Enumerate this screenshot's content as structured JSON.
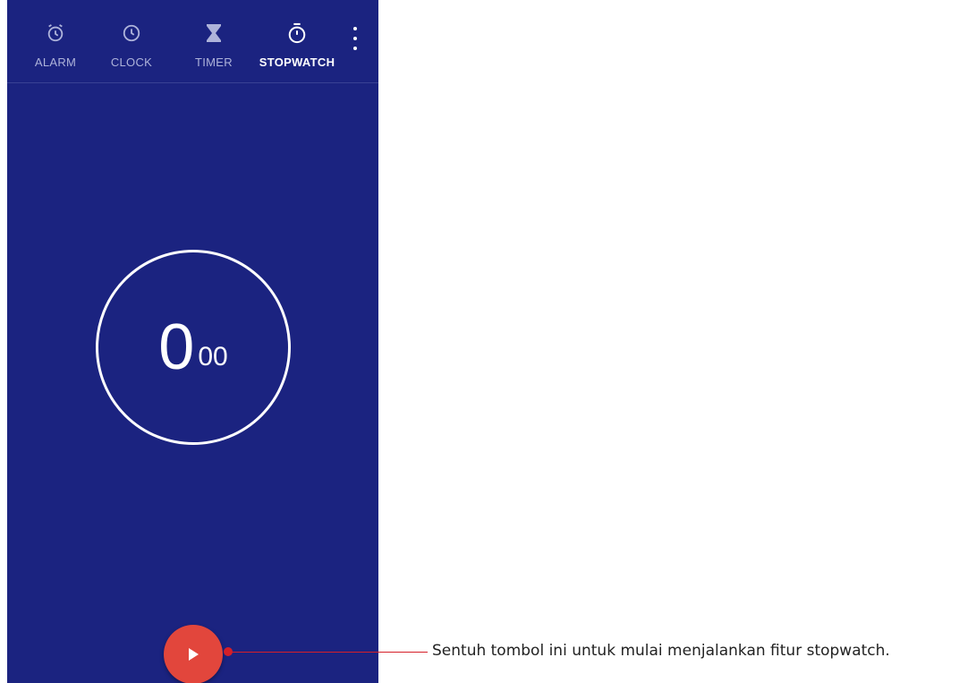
{
  "tabs": [
    {
      "label": "ALARM",
      "icon": "alarm-icon",
      "active": false
    },
    {
      "label": "CLOCK",
      "icon": "clock-icon",
      "active": false
    },
    {
      "label": "TIMER",
      "icon": "hourglass-icon",
      "active": false
    },
    {
      "label": "STOPWATCH",
      "icon": "stopwatch-icon",
      "active": true
    }
  ],
  "overflow_menu": {
    "icon": "more-vert-icon"
  },
  "stopwatch": {
    "seconds": "0",
    "hundredths": "00"
  },
  "start_button": {
    "icon": "play-icon"
  },
  "callout": {
    "text": "Sentuh tombol ini untuk mulai menjalankan fitur stopwatch."
  },
  "colors": {
    "background": "#1b2380",
    "accent": "#e2463c",
    "callout": "#d51f28"
  }
}
